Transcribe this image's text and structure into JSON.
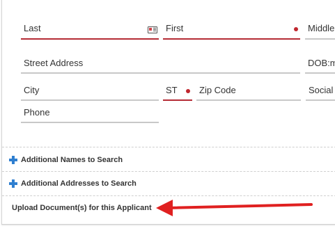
{
  "form": {
    "fields": {
      "last": "Last",
      "first": "First",
      "middle": "Middle",
      "street": "Street Address",
      "dob": "DOB:m",
      "city": "City",
      "state": "ST",
      "zip": "Zip Code",
      "social": "Social",
      "phone": "Phone"
    },
    "required_color": "#b52b35",
    "icons": {
      "last_field": "id-card-icon",
      "required": "required-dot-icon"
    }
  },
  "sections": {
    "additional_names": "Additional Names to Search",
    "additional_addresses": "Additional Addresses to Search",
    "upload": "Upload Document(s) for this Applicant"
  },
  "annotation": {
    "arrow_color": "#e02020",
    "arrow_icon": "red-arrow-pointer"
  }
}
